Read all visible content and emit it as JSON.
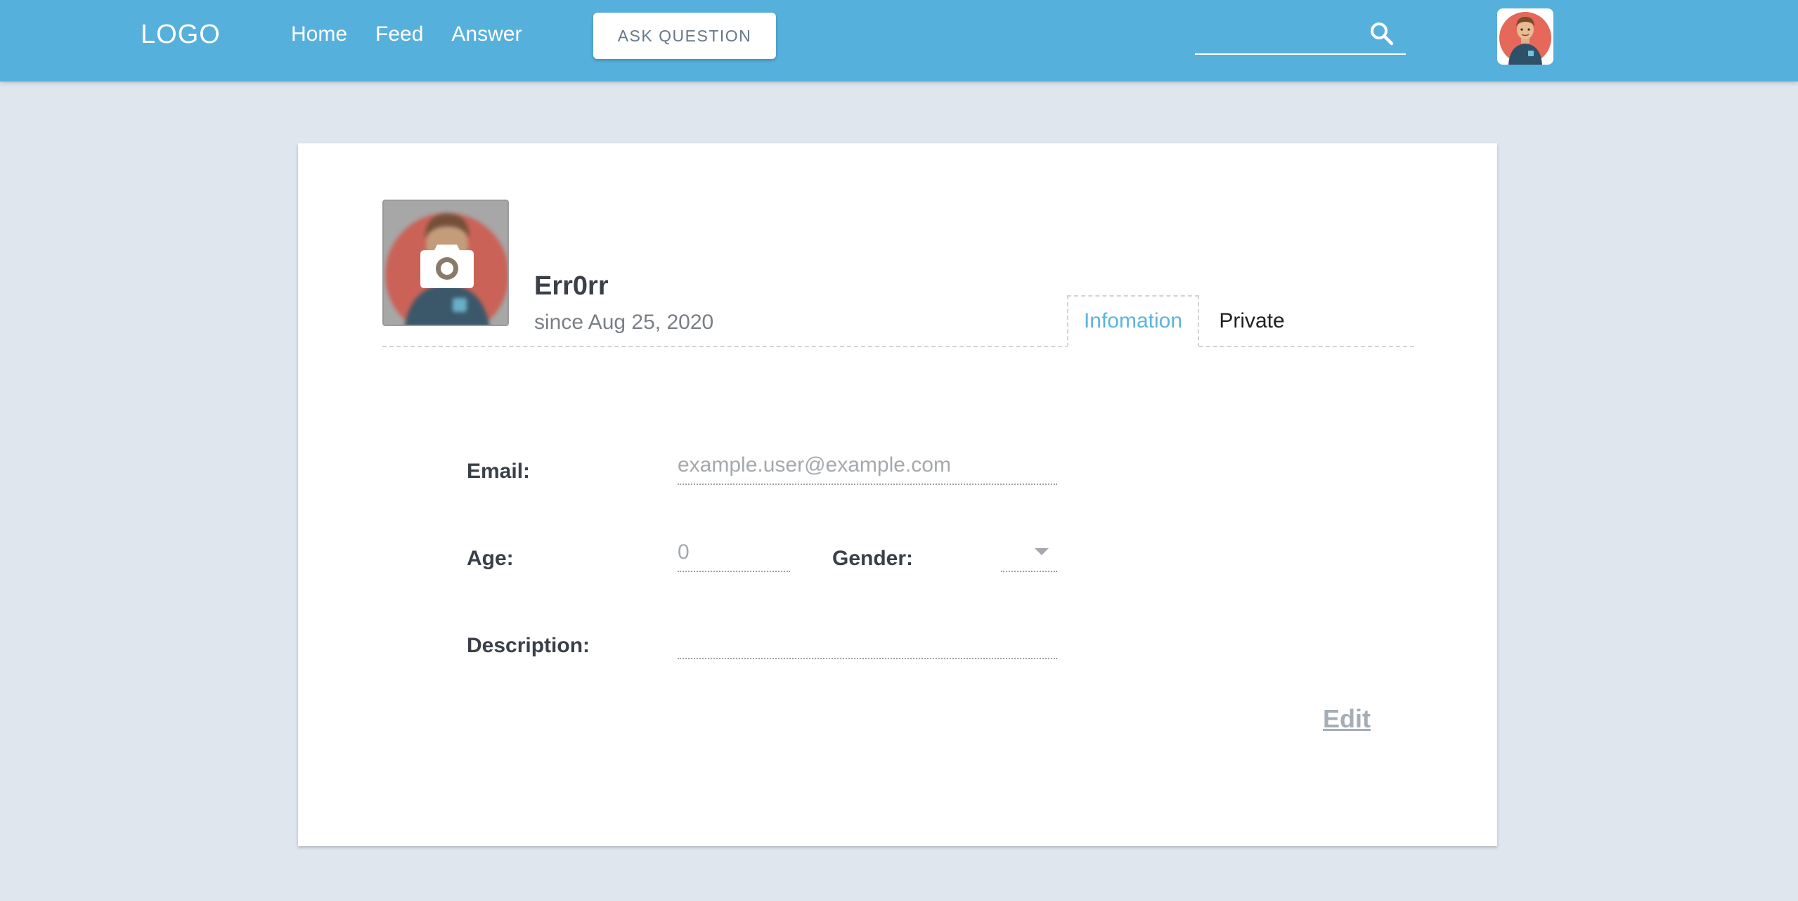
{
  "header": {
    "logo": "LOGO",
    "nav": [
      {
        "label": "Home"
      },
      {
        "label": "Feed"
      },
      {
        "label": "Answer"
      }
    ],
    "ask_button": "ASK QUESTION",
    "search": {
      "placeholder": "",
      "icon": "search-icon"
    },
    "avatar_icon": "user-avatar-icon"
  },
  "profile": {
    "username": "Err0rr",
    "since": "since Aug 25, 2020",
    "photo_icon": "camera-icon",
    "tabs": [
      {
        "label": "Infomation",
        "active": true
      },
      {
        "label": "Private",
        "active": false
      }
    ]
  },
  "form": {
    "email": {
      "label": "Email:",
      "value": "",
      "placeholder": "example.user@example.com"
    },
    "age": {
      "label": "Age:",
      "value": "",
      "placeholder": "0"
    },
    "gender": {
      "label": "Gender:",
      "value": ""
    },
    "description": {
      "label": "Description:",
      "value": "",
      "placeholder": ""
    },
    "edit": "Edit"
  },
  "colors": {
    "header_bg": "#56b0dc",
    "page_bg": "#dfe6ee",
    "accent": "#5bb4de",
    "avatar_circle": "#e5685a",
    "shirt": "#2e5168"
  }
}
